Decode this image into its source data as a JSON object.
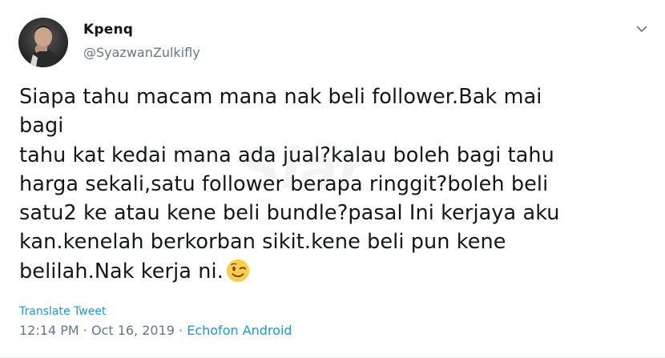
{
  "tweet": {
    "author": {
      "name": "Kpenq",
      "handle": "@SyazwanZulkifly"
    },
    "lines": [
      "Siapa tahu macam mana nak beli follower.Bak mai bagi",
      "tahu kat kedai mana ada jual?kalau boleh bagi tahu",
      "harga sekali,satu follower berapa ringgit?boleh beli",
      "satu2 ke atau kene beli bundle?pasal Ini kerjaya aku",
      "kan.kenelah berkorban sikit.kene beli pun kene",
      "belilah.Nak kerja ni."
    ],
    "emoji": "winking-face",
    "translate_label": "Translate Tweet",
    "time": "12:14 PM",
    "separator": "·",
    "date": "Oct 16, 2019",
    "source": "Echofon Android"
  },
  "watermark_text": "Siar",
  "colors": {
    "link": "#1b95e0",
    "muted": "#657786",
    "text": "#14171a"
  }
}
